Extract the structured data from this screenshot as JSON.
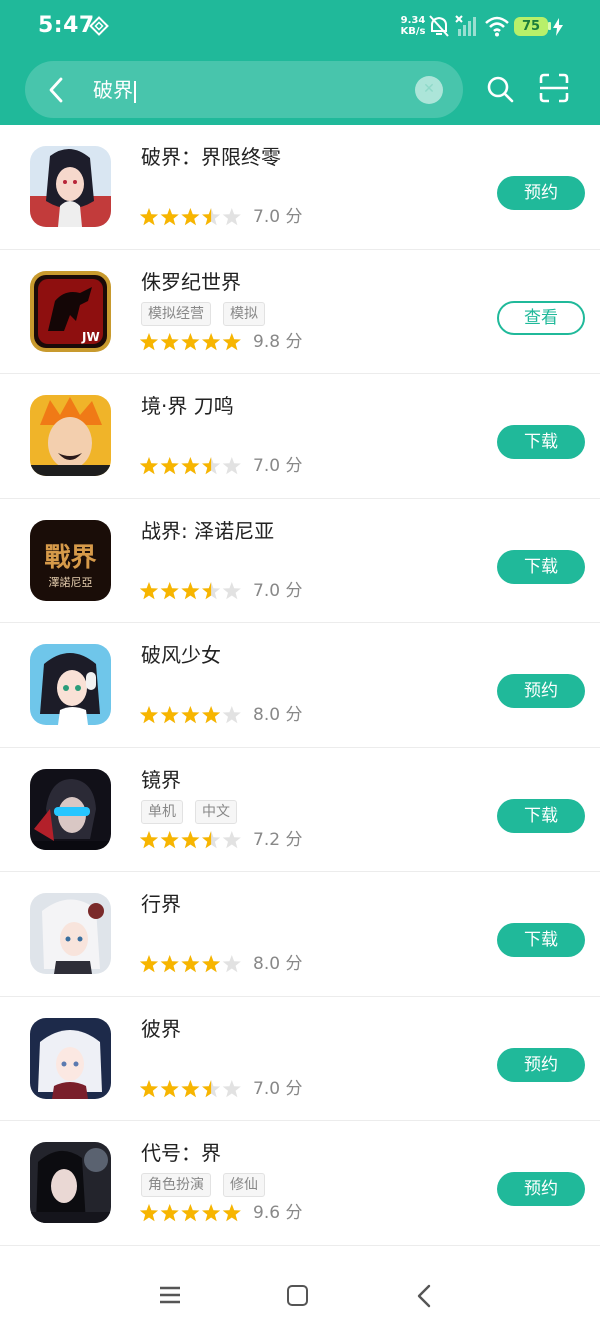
{
  "status_bar": {
    "time": "5:47",
    "net_speed_value": "9.34",
    "net_speed_unit": "KB/s",
    "battery": "75",
    "icons": [
      "mute-icon",
      "signal-icon",
      "wifi-icon",
      "charging-icon"
    ]
  },
  "search": {
    "query": "破界",
    "back_icon": "chevron-left-icon",
    "clear_icon": "clear-icon",
    "search_icon": "search-icon",
    "scan_icon": "scan-icon"
  },
  "theme": {
    "accent": "#20b99a",
    "star": "#f7b500",
    "star_empty": "#e2e2e2"
  },
  "apps": [
    {
      "name": "破界：界限终零",
      "tags": [],
      "rating": 3.5,
      "score": "7.0 分",
      "action": "预约"
    },
    {
      "name": "侏罗纪世界",
      "tags": [
        "模拟经营",
        "模拟"
      ],
      "rating": 5,
      "score": "9.8 分",
      "action": "查看"
    },
    {
      "name": "境·界 刀鸣",
      "tags": [],
      "rating": 3.5,
      "score": "7.0 分",
      "action": "下载"
    },
    {
      "name": "战界: 泽诺尼亚",
      "tags": [],
      "rating": 3.5,
      "score": "7.0 分",
      "action": "下载",
      "icon_text": "戰界",
      "icon_subtext": "澤諾尼亞"
    },
    {
      "name": "破风少女",
      "tags": [],
      "rating": 4,
      "score": "8.0 分",
      "action": "预约"
    },
    {
      "name": "镜界",
      "tags": [
        "单机",
        "中文"
      ],
      "rating": 3.5,
      "score": "7.2 分",
      "action": "下载"
    },
    {
      "name": "行界",
      "tags": [],
      "rating": 4,
      "score": "8.0 分",
      "action": "下载"
    },
    {
      "name": "彼界",
      "tags": [],
      "rating": 3.5,
      "score": "7.0 分",
      "action": "预约"
    },
    {
      "name": "代号：界",
      "tags": [
        "角色扮演",
        "修仙"
      ],
      "rating": 5,
      "score": "9.6 分",
      "action": "预约"
    }
  ],
  "nav": {
    "menu_icon": "menu-icon",
    "home_icon": "home-icon",
    "back_icon": "back-icon"
  }
}
